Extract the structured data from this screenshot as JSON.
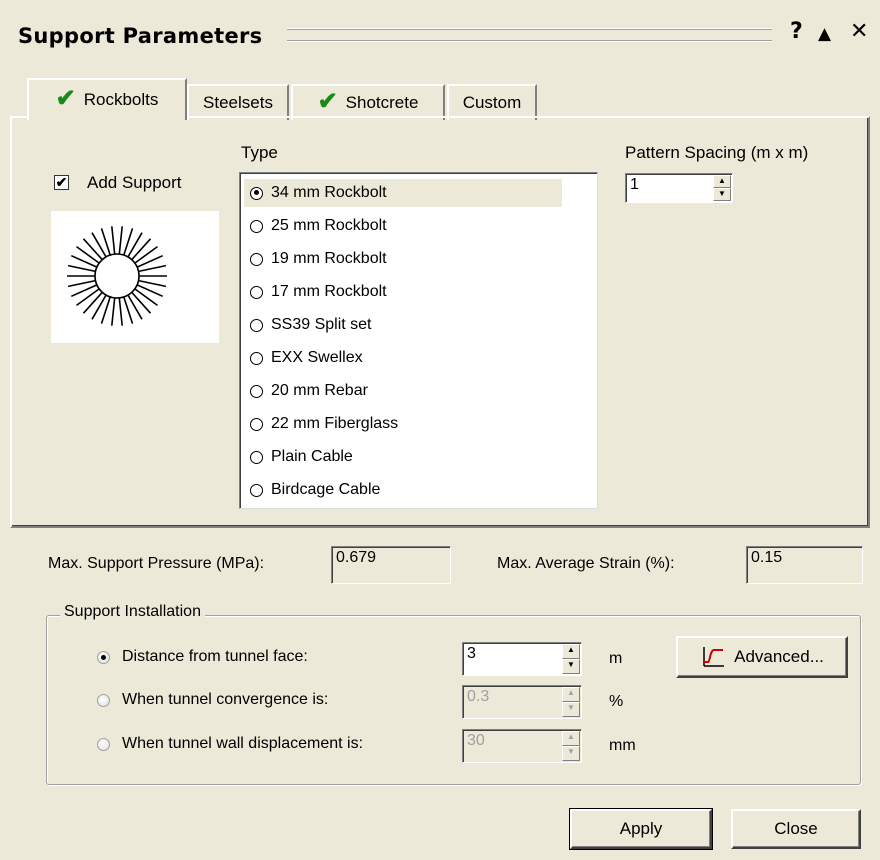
{
  "window": {
    "title": "Support Parameters",
    "help_label": "?",
    "collapse_label": "▲",
    "close_label": "✕"
  },
  "tabs": [
    {
      "label": "Rockbolts",
      "checked": true,
      "active": true
    },
    {
      "label": "Steelsets",
      "checked": false,
      "active": false
    },
    {
      "label": "Shotcrete",
      "checked": true,
      "active": false
    },
    {
      "label": "Custom",
      "checked": false,
      "active": false
    }
  ],
  "rockbolts": {
    "add_support_label": "Add Support",
    "add_support_checked": true,
    "type_label": "Type",
    "types": [
      {
        "label": "34 mm Rockbolt",
        "selected": true
      },
      {
        "label": "25 mm Rockbolt",
        "selected": false
      },
      {
        "label": "19 mm Rockbolt",
        "selected": false
      },
      {
        "label": "17 mm Rockbolt",
        "selected": false
      },
      {
        "label": "SS39 Split set",
        "selected": false
      },
      {
        "label": "EXX Swellex",
        "selected": false
      },
      {
        "label": "20 mm Rebar",
        "selected": false
      },
      {
        "label": "22 mm Fiberglass",
        "selected": false
      },
      {
        "label": "Plain Cable",
        "selected": false
      },
      {
        "label": "Birdcage Cable",
        "selected": false
      }
    ],
    "pattern_spacing_label": "Pattern Spacing (m x m)",
    "pattern_spacing_value": "1"
  },
  "results": {
    "max_pressure_label": "Max. Support Pressure (MPa):",
    "max_pressure_value": "0.679",
    "max_strain_label": "Max. Average Strain (%):",
    "max_strain_value": "0.15"
  },
  "installation": {
    "group_label": "Support Installation",
    "options": [
      {
        "label": "Distance from tunnel face:",
        "value": "3",
        "unit": "m",
        "selected": true,
        "enabled": true
      },
      {
        "label": "When tunnel convergence is:",
        "value": "0.3",
        "unit": "%",
        "selected": false,
        "enabled": false
      },
      {
        "label": "When tunnel wall displacement is:",
        "value": "30",
        "unit": "mm",
        "selected": false,
        "enabled": false
      }
    ],
    "advanced_label": "Advanced..."
  },
  "footer": {
    "apply_label": "Apply",
    "close_label": "Close"
  },
  "colors": {
    "background": "#ece9d8",
    "check_green": "#1a8a1a",
    "advanced_icon_red": "#cc0000"
  }
}
